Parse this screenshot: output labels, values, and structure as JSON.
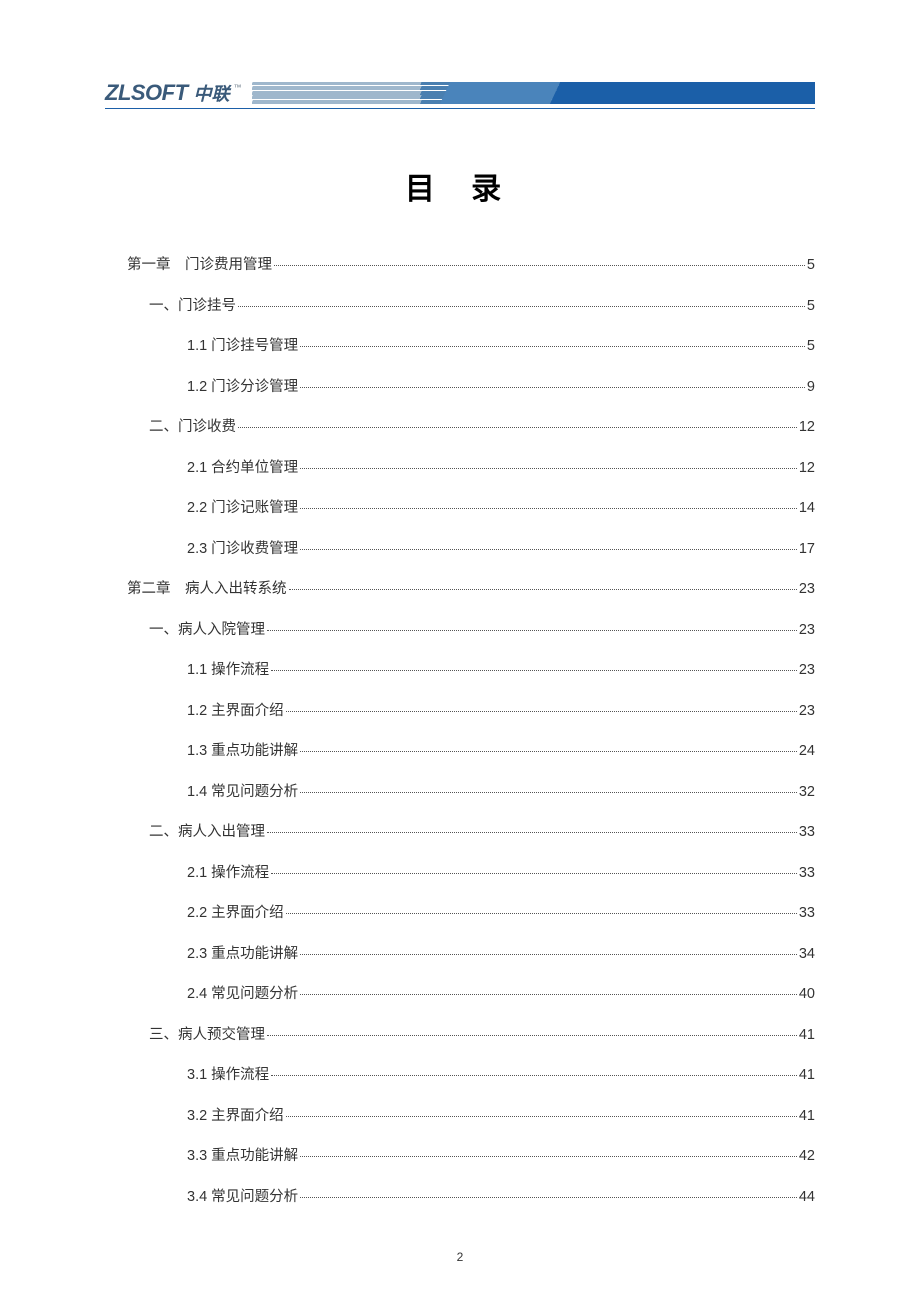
{
  "logo": {
    "en": "ZLSOFT",
    "cn": "中联",
    "tm": "™"
  },
  "title": "目 录",
  "page_number": "2",
  "toc": [
    {
      "level": 1,
      "chapter": "第一章",
      "title": "门诊费用管理",
      "page": "5"
    },
    {
      "level": 2,
      "title": "一、门诊挂号",
      "page": "5"
    },
    {
      "level": 3,
      "title": "1.1 门诊挂号管理",
      "page": "5"
    },
    {
      "level": 3,
      "title": "1.2 门诊分诊管理",
      "page": "9"
    },
    {
      "level": 2,
      "title": "二、门诊收费",
      "page": "12"
    },
    {
      "level": 3,
      "title": "2.1 合约单位管理",
      "page": "12"
    },
    {
      "level": 3,
      "title": "2.2 门诊记账管理",
      "page": "14"
    },
    {
      "level": 3,
      "title": "2.3 门诊收费管理",
      "page": "17"
    },
    {
      "level": 1,
      "chapter": "第二章",
      "title": "病人入出转系统",
      "page": "23"
    },
    {
      "level": 2,
      "title": "一、病人入院管理",
      "page": "23"
    },
    {
      "level": 3,
      "title": "1.1 操作流程",
      "page": "23"
    },
    {
      "level": 3,
      "title": "1.2 主界面介绍",
      "page": "23"
    },
    {
      "level": 3,
      "title": "1.3 重点功能讲解",
      "page": "24"
    },
    {
      "level": 3,
      "title": "1.4 常见问题分析",
      "page": "32"
    },
    {
      "level": 2,
      "title": "二、病人入出管理",
      "page": "33"
    },
    {
      "level": 3,
      "title": "2.1 操作流程",
      "page": "33"
    },
    {
      "level": 3,
      "title": "2.2 主界面介绍",
      "page": "33"
    },
    {
      "level": 3,
      "title": "2.3 重点功能讲解",
      "page": "34"
    },
    {
      "level": 3,
      "title": "2.4 常见问题分析",
      "page": "40"
    },
    {
      "level": 2,
      "title": "三、病人预交管理",
      "page": "41"
    },
    {
      "level": 3,
      "title": "3.1 操作流程",
      "page": "41"
    },
    {
      "level": 3,
      "title": "3.2 主界面介绍",
      "page": "41"
    },
    {
      "level": 3,
      "title": "3.3 重点功能讲解",
      "page": "42"
    },
    {
      "level": 3,
      "title": "3.4 常见问题分析",
      "page": "44"
    }
  ]
}
